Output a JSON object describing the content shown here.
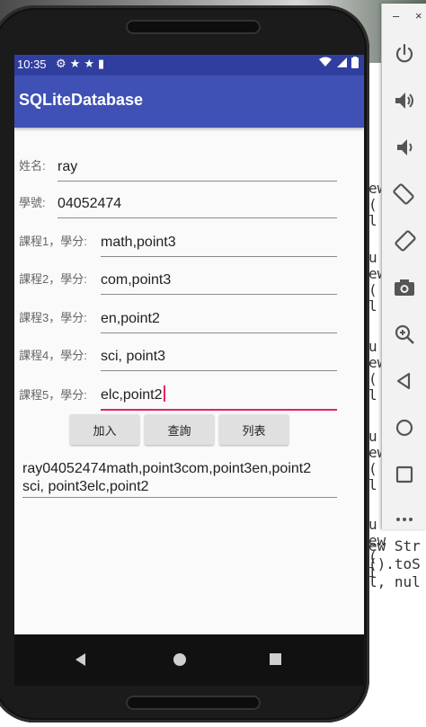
{
  "status_bar": {
    "time": "10:35",
    "left_icons": [
      "settings-icon",
      "star-icon",
      "star-icon",
      "sd-card-icon"
    ],
    "right_icons": [
      "wifi-icon",
      "signal-icon",
      "battery-icon"
    ]
  },
  "app_bar": {
    "title": "SQLiteDatabase"
  },
  "form": {
    "fields": [
      {
        "label": "姓名:",
        "value": "ray"
      },
      {
        "label": "學號:",
        "value": "04052474"
      },
      {
        "label": "課程1，學分:",
        "value": "math,point3"
      },
      {
        "label": "課程2，學分:",
        "value": "com,point3"
      },
      {
        "label": "課程3，學分:",
        "value": "en,point2"
      },
      {
        "label": "課程4，學分:",
        "value": "sci, point3"
      },
      {
        "label": "課程5，學分:",
        "value": "elc,point2"
      }
    ]
  },
  "buttons": {
    "add": "加入",
    "query": "查詢",
    "list": "列表"
  },
  "result": {
    "line1": "ray04052474math,point3com,point3en,point2",
    "line2": "sci, point3elc,point2"
  },
  "side_panel": {
    "minimize": "–",
    "close": "×",
    "tools": [
      "power-icon",
      "volume-up-icon",
      "volume-down-icon",
      "rotate-left-icon",
      "rotate-right-icon",
      "camera-icon",
      "zoom-in-icon",
      "back-icon",
      "home-icon",
      "overview-icon",
      "more-icon"
    ]
  },
  "background_code": {
    "lines": [
      "ew",
      "(",
      "l",
      "u",
      "ew",
      "(",
      "l",
      "u",
      "ew",
      "(",
      "l",
      "u",
      "ew",
      "(",
      "l",
      "u",
      "ew",
      "(",
      "l",
      "ew Str",
      "().toS",
      "l, nul"
    ]
  },
  "colors": {
    "primary": "#3f51b5",
    "primary_dark": "#303f9f",
    "accent": "#e91e63"
  }
}
